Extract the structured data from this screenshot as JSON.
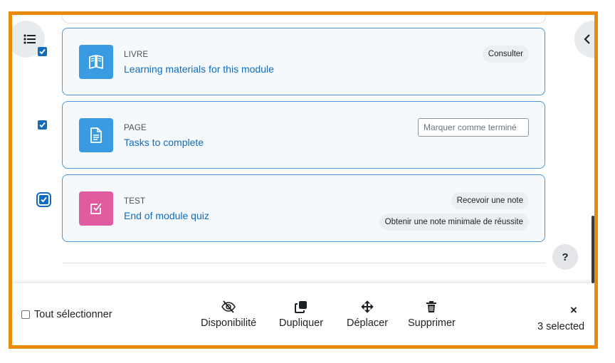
{
  "colors": {
    "frame": "#e88a0c",
    "accent": "#0f6cbf",
    "book_icon_bg": "#399be2",
    "quiz_icon_bg": "#e05ba0"
  },
  "activities": [
    {
      "type": "LIVRE",
      "name": "Learning materials for this module",
      "icon": "book-icon",
      "completion": [
        {
          "kind": "pill",
          "label": "Consulter"
        }
      ]
    },
    {
      "type": "PAGE",
      "name": "Tasks to complete",
      "icon": "page-icon",
      "completion": [
        {
          "kind": "button",
          "label": "Marquer comme terminé"
        }
      ]
    },
    {
      "type": "TEST",
      "name": "End of module quiz",
      "icon": "quiz-icon",
      "completion": [
        {
          "kind": "pill",
          "label": "Recevoir une note"
        },
        {
          "kind": "pill",
          "label": "Obtenir une note minimale de réussite"
        }
      ]
    }
  ],
  "help": {
    "label": "?"
  },
  "footer": {
    "select_all_label": "Tout sélectionner",
    "actions": [
      {
        "label": "Disponibilité",
        "icon": "eye-slash-icon"
      },
      {
        "label": "Dupliquer",
        "icon": "copy-icon"
      },
      {
        "label": "Déplacer",
        "icon": "move-icon"
      },
      {
        "label": "Supprimer",
        "icon": "trash-icon"
      }
    ],
    "close_label": "×",
    "selected_text": "3 selected"
  }
}
